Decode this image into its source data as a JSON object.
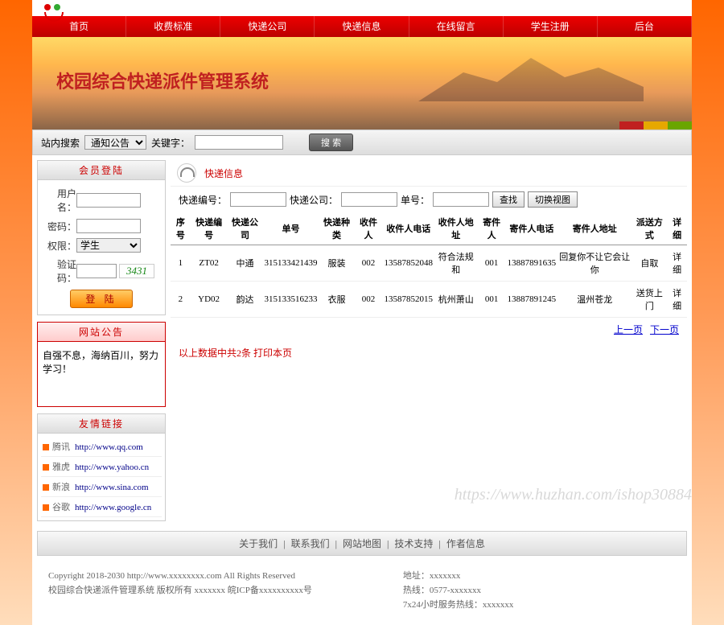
{
  "nav": [
    "首页",
    "收费标准",
    "快递公司",
    "快递信息",
    "在线留言",
    "学生注册",
    "后台"
  ],
  "banner": {
    "title": "校园综合快递派件管理系统"
  },
  "search": {
    "label": "站内搜索",
    "select_option": "通知公告",
    "keyword_label": "关键字：",
    "button": "搜 索"
  },
  "login_panel": {
    "title": "会员登陆",
    "username": "用户名：",
    "password": "密码：",
    "role": "权限：",
    "role_option": "学生",
    "captcha": "验证码：",
    "captcha_value": "3431",
    "button": "登 陆"
  },
  "notice_panel": {
    "title": "网站公告",
    "content": "自强不息，海纳百川，努力学习！"
  },
  "links_panel": {
    "title": "友情链接",
    "items": [
      {
        "name": "腾讯",
        "url": "http://www.qq.com"
      },
      {
        "name": "雅虎",
        "url": "http://www.yahoo.cn"
      },
      {
        "name": "新浪",
        "url": "http://www.sina.com"
      },
      {
        "name": "谷歌",
        "url": "http://www.google.cn"
      }
    ]
  },
  "content": {
    "title": "快递信息",
    "filter": {
      "f1": "快递编号：",
      "f2": "快递公司：",
      "f3": "单号：",
      "btn_search": "查找",
      "btn_view": "切换视图"
    },
    "headers": [
      "序号",
      "快递编号",
      "快递公司",
      "单号",
      "快递种类",
      "收件人",
      "收件人电话",
      "收件人地址",
      "寄件人",
      "寄件人电话",
      "寄件人地址",
      "派送方式",
      "详细"
    ],
    "rows": [
      {
        "c0": "1",
        "c1": "ZT02",
        "c2": "中通",
        "c3": "315133421439",
        "c4": "服装",
        "c5": "002",
        "c6": "13587852048",
        "c7": "符合法规和",
        "c8": "001",
        "c9": "13887891635",
        "c10": "回复你不让它会让你",
        "c11": "自取",
        "c12": "详细"
      },
      {
        "c0": "2",
        "c1": "YD02",
        "c2": "韵达",
        "c3": "315133516233",
        "c4": "衣服",
        "c5": "002",
        "c6": "13587852015",
        "c7": "杭州萧山",
        "c8": "001",
        "c9": "13887891245",
        "c10": "温州苍龙",
        "c11": "送货上门",
        "c12": "详细"
      }
    ],
    "pager": {
      "prev": "上一页",
      "next": "下一页"
    },
    "summary": "以上数据中共2条 打印本页"
  },
  "footer_nav": [
    "关于我们",
    "联系我们",
    "网站地图",
    "技术支持",
    "作者信息"
  ],
  "footer": {
    "left1": "Copyright 2018-2030 http://www.xxxxxxxx.com All Rights Reserved",
    "left2": "校园综合快递派件管理系统 版权所有 xxxxxxx 皖ICP备xxxxxxxxxx号",
    "right1": "地址：xxxxxxx",
    "right2": "热线：0577-xxxxxxx",
    "right3": "7x24小时服务热线：xxxxxxx"
  },
  "watermark": "https://www.huzhan.com/ishop30884",
  "colors": {
    "b1": "#7a552c",
    "b2": "#c02020",
    "b3": "#e6a800",
    "b4": "#6aa500"
  }
}
